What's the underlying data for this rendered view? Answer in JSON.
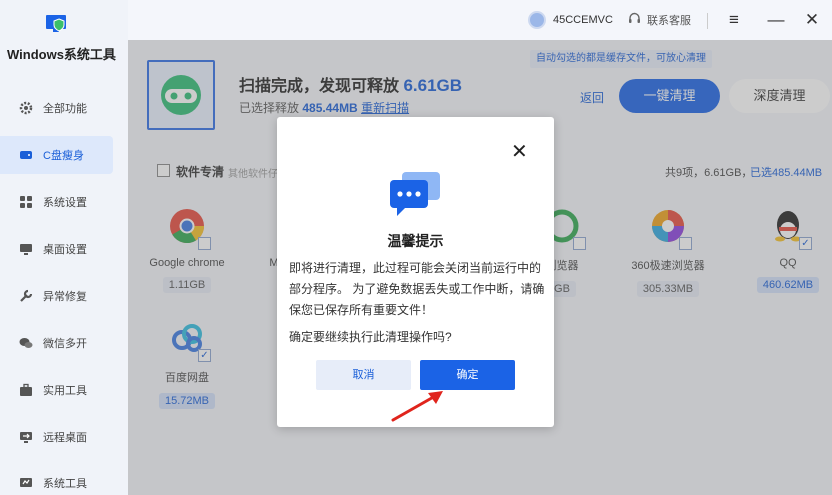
{
  "app": {
    "title": "Windows系统工具"
  },
  "sidebar": {
    "items": [
      {
        "label": "全部功能",
        "icon": "gear-icon"
      },
      {
        "label": "C盘瘦身",
        "icon": "disk-icon",
        "active": true
      },
      {
        "label": "系统设置",
        "icon": "grid-icon"
      },
      {
        "label": "桌面设置",
        "icon": "monitor-icon"
      },
      {
        "label": "异常修复",
        "icon": "wrench-icon"
      },
      {
        "label": "微信多开",
        "icon": "chat-icon"
      },
      {
        "label": "实用工具",
        "icon": "toolbox-icon"
      },
      {
        "label": "远程桌面",
        "icon": "remote-icon"
      },
      {
        "label": "系统工具",
        "icon": "tools-icon"
      }
    ]
  },
  "topbar": {
    "username": "45CCEMVC",
    "service": "联系客服",
    "menu_icon": "≡",
    "min_icon": "—",
    "close_icon": "✕"
  },
  "scan": {
    "tip": "自动勾选的都是缓存文件，可放心清理",
    "title_prefix": "扫描完成，发现可释放",
    "title_amount": "6.61GB",
    "sub_prefix": "已选择释放",
    "sub_amount": "485.44MB",
    "rescan": "重新扫描",
    "back": "返回",
    "oneclick": "一键清理",
    "deep": "深度清理"
  },
  "section": {
    "label": "软件专清",
    "hint": "其他软件仔",
    "count": "共9项，6.61GB，",
    "selected": "已选485.44MB"
  },
  "apps": [
    {
      "name": "Google chrome",
      "size": "1.11GB",
      "selected": false
    },
    {
      "name": "M",
      "size": "",
      "selected": false
    },
    {
      "name": "浏览器",
      "size": "GB",
      "selected": false
    },
    {
      "name": "360极速浏览器",
      "size": "305.33MB",
      "selected": false
    },
    {
      "name": "QQ",
      "size": "460.62MB",
      "selected": true
    },
    {
      "name": "百度网盘",
      "size": "15.72MB",
      "selected": true
    }
  ],
  "dialog": {
    "title": "温馨提示",
    "body": "即将进行清理，此过程可能会关闭当前运行中的部分程序。 为了避免数据丢失或工作中断，请确保您已保存所有重要文件！",
    "question": "确定要继续执行此清理操作吗?",
    "cancel": "取消",
    "confirm": "确定"
  },
  "colors": {
    "accent": "#1b63e6",
    "overlay": "rgba(110,110,110,0.35)"
  }
}
